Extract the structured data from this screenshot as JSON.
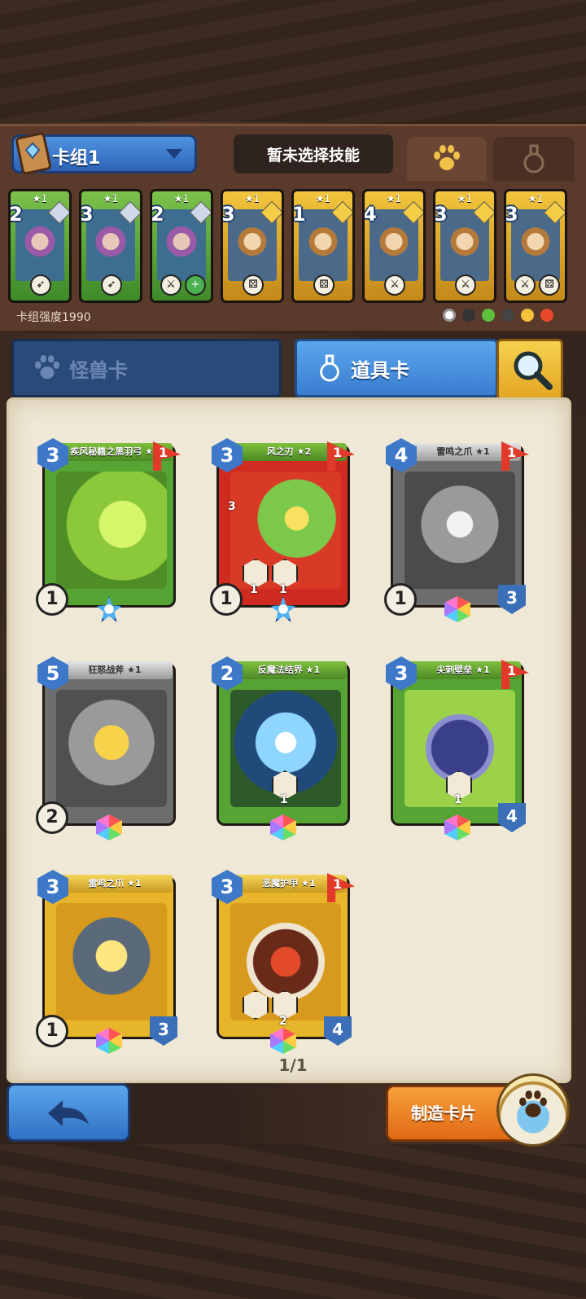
{
  "deck": {
    "name": "卡组1",
    "skill_status": "暂未选择技能",
    "strength_text": "卡组强度1990",
    "cards": [
      {
        "cost": "2",
        "stars": "★1",
        "rarity": "green"
      },
      {
        "cost": "3",
        "stars": "★1",
        "rarity": "green"
      },
      {
        "cost": "2",
        "stars": "★1",
        "rarity": "green"
      },
      {
        "cost": "3",
        "stars": "★1",
        "rarity": "gold"
      },
      {
        "cost": "1",
        "stars": "★1",
        "rarity": "gold"
      },
      {
        "cost": "4",
        "stars": "★1",
        "rarity": "gold"
      },
      {
        "cost": "3",
        "stars": "★1",
        "rarity": "gold"
      },
      {
        "cost": "3",
        "stars": "★1",
        "rarity": "gold"
      }
    ]
  },
  "tabs": {
    "monster": "怪兽卡",
    "item": "道具卡"
  },
  "item_cards": [
    {
      "name": "疾风秘籍之黑羽弓 ★1",
      "cost": "3",
      "flag": "1",
      "attack": "1",
      "color": "green"
    },
    {
      "name": "风之刃 ★2",
      "cost": "3",
      "flag": "1",
      "attack": "1",
      "color": "red",
      "ability_values": [
        "1",
        "1"
      ],
      "side_value": "3"
    },
    {
      "name": "雷鸣之爪 ★1",
      "cost": "4",
      "flag": "1",
      "attack": "1",
      "defense": "3",
      "color": "gray"
    },
    {
      "name": "狂怒战斧 ★1",
      "cost": "5",
      "attack": "2",
      "color": "gray"
    },
    {
      "name": "反魔法结界 ★1",
      "cost": "2",
      "ability_values": [
        "1"
      ],
      "color": "green"
    },
    {
      "name": "尖刺壁垒 ★1",
      "cost": "3",
      "flag": "1",
      "defense": "4",
      "ability_values": [
        "1"
      ],
      "color": "green"
    },
    {
      "name": "雷鸣之爪 ★1",
      "cost": "3",
      "attack": "1",
      "defense": "3",
      "color": "yellow"
    },
    {
      "name": "恶魔护甲 ★1",
      "cost": "3",
      "flag": "1",
      "defense": "4",
      "ability_values": [
        "2"
      ],
      "color": "yellow"
    }
  ],
  "pagination": "1/1",
  "buttons": {
    "craft": "制造卡片"
  }
}
